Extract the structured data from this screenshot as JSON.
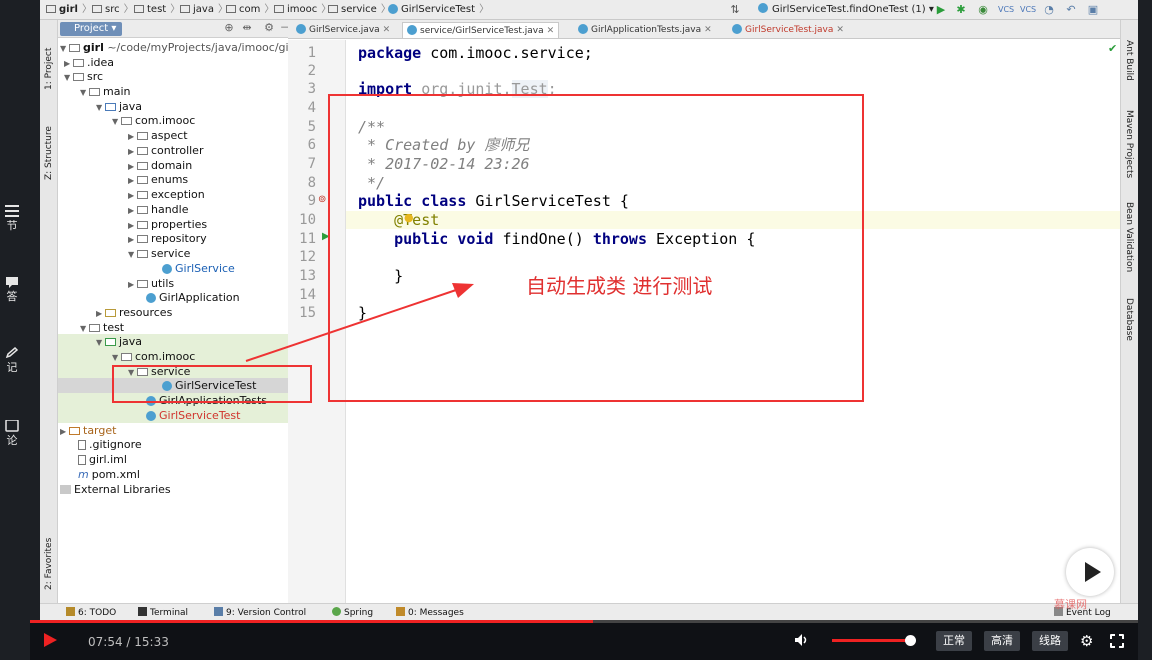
{
  "course_sidebar": {
    "items": [
      {
        "label": "节",
        "icon": "list-icon"
      },
      {
        "label": "答",
        "icon": "chat-icon"
      },
      {
        "label": "记",
        "icon": "pencil-icon"
      },
      {
        "label": "论",
        "icon": "comment-icon"
      }
    ]
  },
  "ide": {
    "breadcrumbs": [
      "girl",
      "src",
      "test",
      "java",
      "com",
      "imooc",
      "service",
      "GirlServiceTest"
    ],
    "run_config": "GirlServiceTest.findOneTest (1)",
    "project_tab": "Project",
    "left_tool_tabs": [
      "1: Project",
      "Z: Structure",
      "2: Favorites"
    ],
    "right_tool_tabs": [
      "Ant Build",
      "Maven Projects",
      "Bean Validation",
      "Database"
    ],
    "tree": [
      {
        "label": "girl",
        "suffix": "~/code/myProjects/java/imooc/gi",
        "bold": true
      },
      {
        "label": ".idea"
      },
      {
        "label": "src"
      },
      {
        "label": "main"
      },
      {
        "label": "java"
      },
      {
        "label": "com.imooc"
      },
      {
        "label": "aspect"
      },
      {
        "label": "controller"
      },
      {
        "label": "domain"
      },
      {
        "label": "enums"
      },
      {
        "label": "exception"
      },
      {
        "label": "handle"
      },
      {
        "label": "properties"
      },
      {
        "label": "repository"
      },
      {
        "label": "service"
      },
      {
        "label": "GirlService"
      },
      {
        "label": "utils"
      },
      {
        "label": "GirlApplication"
      },
      {
        "label": "resources"
      },
      {
        "label": "test"
      },
      {
        "label": "java"
      },
      {
        "label": "com.imooc"
      },
      {
        "label": "service"
      },
      {
        "label": "GirlServiceTest"
      },
      {
        "label": "GirlApplicationTests"
      },
      {
        "label": "GirlServiceTest"
      },
      {
        "label": "target"
      },
      {
        "label": ".gitignore"
      },
      {
        "label": "girl.iml"
      },
      {
        "label": "pom.xml"
      },
      {
        "label": "External Libraries"
      }
    ],
    "editor_tabs": [
      {
        "label": "GirlService.java"
      },
      {
        "label": "service/GirlServiceTest.java"
      },
      {
        "label": "GirlApplicationTests.java"
      },
      {
        "label": "GirlServiceTest.java"
      }
    ],
    "code": {
      "line_numbers": [
        "1",
        "2",
        "3",
        "4",
        "5",
        "6",
        "7",
        "8",
        "9",
        "10",
        "11",
        "12",
        "13",
        "14",
        "15"
      ],
      "l1_kw": "package",
      "l1_rest": " com.imooc.service;",
      "l3_kw": "import",
      "l3_rest": " org.junit.",
      "l3_cls": "Test",
      "l3_end": ";",
      "l5": "/**",
      "l6": " * Created by 廖师兄",
      "l7": " * 2017-02-14 23:26",
      "l8": " */",
      "l9_kw": "public class",
      "l9_rest": " GirlServiceTest {",
      "l10": "    @Test",
      "l11_kw1": "    public void",
      "l11_mid": " findOne() ",
      "l11_kw2": "throws",
      "l11_end": " Exception {",
      "l13": "    }",
      "l15": "}"
    },
    "bottom_tools": [
      {
        "label": "6: TODO"
      },
      {
        "label": "Terminal"
      },
      {
        "label": "9: Version Control"
      },
      {
        "label": "Spring"
      },
      {
        "label": "0: Messages"
      },
      {
        "label": "Event Log"
      }
    ]
  },
  "annotation": {
    "text": "自动生成类    进行测试",
    "color": "#e03030"
  },
  "watermark": "慕课网",
  "player": {
    "current_time": "07:54",
    "duration": "15:33",
    "time_display": "07:54 / 15:33",
    "progress_fraction": 0.508,
    "volume_fraction": 0.95,
    "speed_label": "正常",
    "quality_label": "高清",
    "route_label": "线路",
    "accent": "#e22222"
  }
}
